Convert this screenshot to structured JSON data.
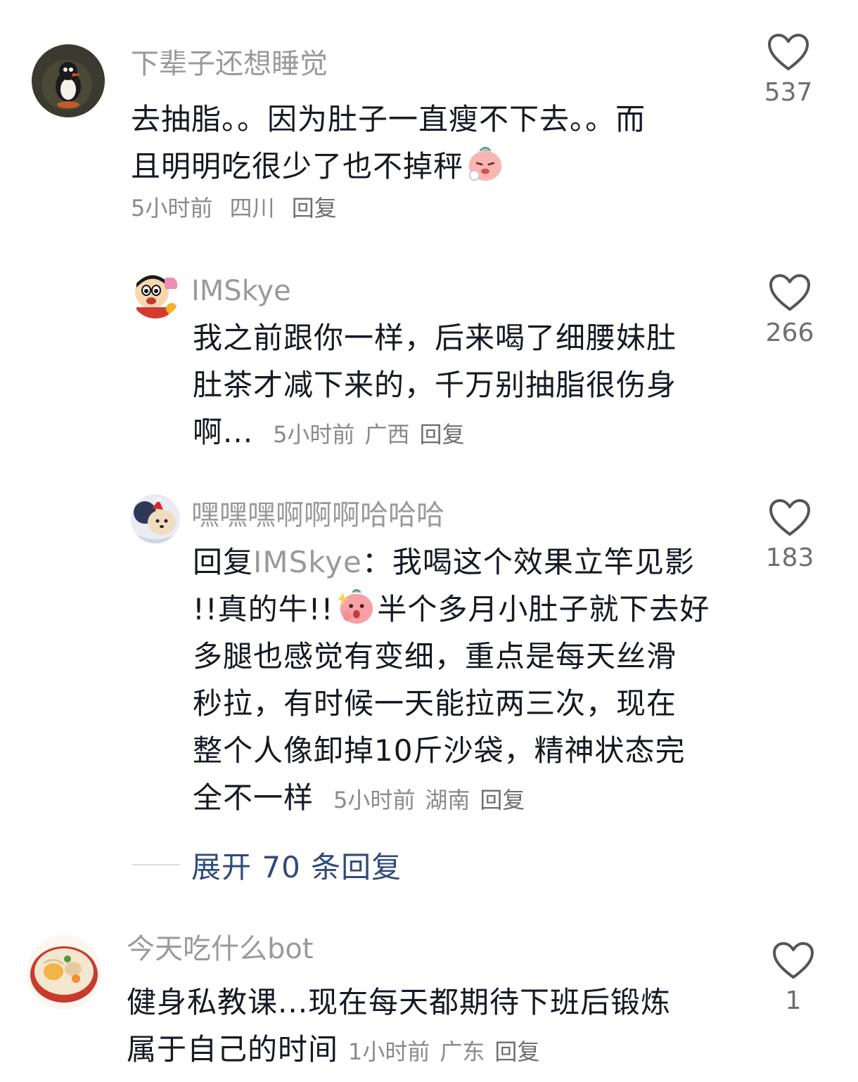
{
  "comments": [
    {
      "username": "下辈子还想睡觉",
      "text_lines": [
        "去抽脂。。因为肚子一直瘦不下去。。而",
        "且明明吃很少了也不掉秤"
      ],
      "emoji": "crying-peach-emoji",
      "time": "5小时前",
      "location": "四川",
      "reply_label": "回复",
      "likes": "537",
      "avatar_icon": "penguin-avatar",
      "replies": [
        {
          "username": "IMSkye",
          "text_lines": [
            "我之前跟你一样，后来喝了细腰妹肚",
            "肚茶才减下来的，千万别抽脂很伤身",
            "啊..."
          ],
          "time": "5小时前",
          "location": "广西",
          "reply_label": "回复",
          "likes": "266",
          "avatar_icon": "cartoon-boy-avatar"
        },
        {
          "username": "嘿嘿嘿啊啊啊哈哈哈",
          "reply_prefix": "回复",
          "mention": "IMSkye",
          "mention_sep": "：",
          "text_lines": [
            "我喝这个效果立竿见影",
            "!!真的牛!!",
            "半个多月小肚子就下去好",
            "多腿也感觉有变细，重点是每天丝滑",
            "秒拉，有时候一天能拉两三次，现在",
            "整个人像卸掉10斤沙袋，精神状态完",
            "全不一样"
          ],
          "emoji": "surprised-peach-emoji",
          "time": "5小时前",
          "location": "湖南",
          "reply_label": "回复",
          "likes": "183",
          "avatar_icon": "dog-christmas-avatar"
        }
      ],
      "expand_label": "展开 70 条回复"
    },
    {
      "username": "今天吃什么bot",
      "text_lines": [
        "健身私教课...现在每天都期待下班后锻炼",
        "属于自己的时间"
      ],
      "time": "1小时前",
      "location": "广东",
      "reply_label": "回复",
      "likes": "1",
      "avatar_icon": "food-bowl-avatar"
    }
  ],
  "colors": {
    "text": "#161823",
    "secondary": "#9a9a9a",
    "meta": "#8a8a8a",
    "link": "#2f4b7c",
    "icon": "#555555"
  },
  "icons": {
    "like": "heart-outline-icon"
  }
}
